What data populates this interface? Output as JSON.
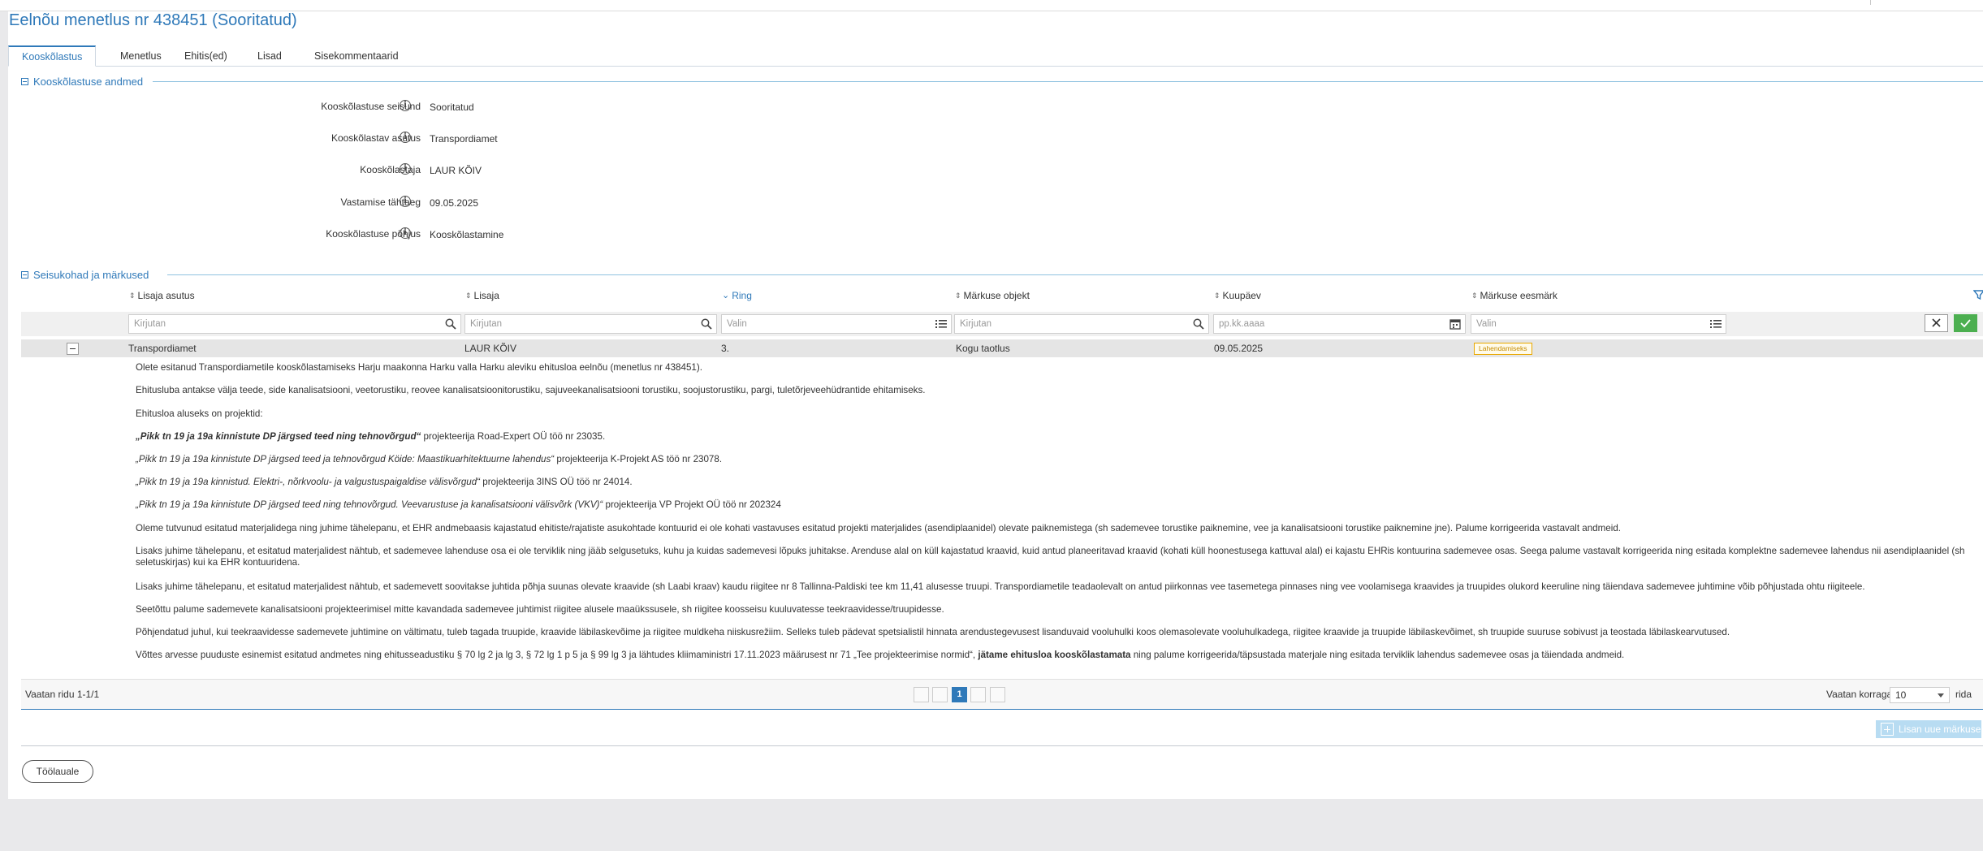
{
  "page": {
    "title": "Eelnõu menetlus nr 438451 (Sooritatud)"
  },
  "tabs": [
    {
      "label": "Kooskõlastus"
    },
    {
      "label": "Menetlus"
    },
    {
      "label": "Ehitis(ed)"
    },
    {
      "label": "Lisad"
    },
    {
      "label": "Sisekommentaarid"
    }
  ],
  "section1": {
    "title": "Kooskõlastuse andmed",
    "fields": [
      {
        "label": "Kooskõlastuse seisund",
        "value": "Sooritatud"
      },
      {
        "label": "Kooskõlastav asutus",
        "value": "Transpordiamet"
      },
      {
        "label": "Kooskõlastaja",
        "value": "LAUR KÕIV"
      },
      {
        "label": "Vastamise tähtaeg",
        "value": "09.05.2025"
      },
      {
        "label": "Kooskõlastuse põhjus",
        "value": "Kooskõlastamine"
      }
    ],
    "info_glyph": "i"
  },
  "section2": {
    "title": "Seisukohad ja märkused"
  },
  "table": {
    "columns": [
      {
        "label": "Lisaja asutus",
        "sort": "⇕"
      },
      {
        "label": "Lisaja",
        "sort": "⇕"
      },
      {
        "label": "Ring",
        "sort": "⌄"
      },
      {
        "label": "Märkuse objekt",
        "sort": "⇕"
      },
      {
        "label": "Kuupäev",
        "sort": "⇕"
      },
      {
        "label": "Märkuse eesmärk",
        "sort": "⇕"
      }
    ],
    "filters": [
      {
        "placeholder": "Kirjutan",
        "icon": "search-icon"
      },
      {
        "placeholder": "Kirjutan",
        "icon": "search-icon"
      },
      {
        "placeholder": "Valin",
        "icon": "list-icon"
      },
      {
        "placeholder": "Kirjutan",
        "icon": "search-icon"
      },
      {
        "placeholder": "pp.kk.aaaa",
        "icon": "calendar-icon"
      },
      {
        "placeholder": "Valin",
        "icon": "list-icon"
      }
    ],
    "row": {
      "asutus": "Transpordiamet",
      "lisaja": "LAUR KÕIV",
      "ring": "3.",
      "objekt": "Kogu taotlus",
      "kuupaev": "09.05.2025",
      "eesmark": "Lahendamiseks"
    },
    "body": {
      "p1": "Olete esitanud Transpordiametile kooskõlastamiseks Harju maakonna Harku valla Harku aleviku ehitusloa eelnõu (menetlus nr 438451).",
      "p2": "Ehitusluba antakse välja teede, side kanalisatsiooni, veetorustiku, reovee kanalisatsioonitorustiku, sajuveekanalisatsiooni torustiku, soojustorustiku, pargi, tuletõrjeveehüdrantide ehitamiseks.",
      "p3": "Ehitusloa aluseks on projektid:",
      "p4_bold": "„Pikk tn 19 ja 19a kinnistute DP järgsed teed ning tehnovõrgud“",
      "p4_rest": " projekteerija Road-Expert OÜ töö nr 23035.",
      "p5_italic": "„Pikk tn 19 ja 19a kinnistute DP järgsed teed ja tehnovõrgud Köide: Maastikuarhitektuurne lahendus“",
      "p5_rest": " projekteerija K-Projekt AS töö nr 23078.",
      "p6_italic": "„Pikk tn 19 ja 19a kinnistud. Elektri-, nõrkvoolu- ja valgustuspaigaldise välisvõrgud“",
      "p6_rest": " projekteerija 3INS OÜ töö nr 24014.",
      "p7_italic": "„Pikk tn 19 ja 19a kinnistute DP järgsed teed ning tehnovõrgud. Veevarustuse ja kanalisatsiooni välisvõrk (VKV)“",
      "p7_rest": " projekteerija VP Projekt OÜ töö nr 202324",
      "p8": "Oleme tutvunud esitatud materjalidega ning juhime tähelepanu, et EHR andmebaasis kajastatud ehitiste/rajatiste asukohtade kontuurid ei ole kohati vastavuses esitatud projekti materjalides (asendiplaanidel) olevate paiknemistega (sh sademevee torustike paiknemine, vee ja kanalisatsiooni torustike paiknemine jne). Palume korrigeerida vastavalt andmeid.",
      "p9": "Lisaks juhime tähelepanu, et esitatud materjalidest nähtub, et sademevee lahenduse osa ei ole terviklik ning jääb selgusetuks, kuhu ja kuidas sademevesi lõpuks juhitakse. Arenduse alal on küll kajastatud kraavid, kuid antud planeeritavad kraavid (kohati küll hoonestusega kattuval alal) ei kajastu EHRis kontuurina sademevee osas. Seega palume vastavalt korrigeerida ning esitada komplektne sademevee lahendus nii asendiplaanidel (sh seletuskirjas) kui ka EHR kontuuridena.",
      "p10": "Lisaks juhime tähelepanu, et esitatud materjalidest nähtub, et sademevett soovitakse juhtida põhja suunas olevate kraavide (sh Laabi kraav) kaudu riigitee nr 8 Tallinna-Paldiski tee km 11,41 alusesse truupi. Transpordiametile teadaolevalt on antud piirkonnas vee tasemetega pinnases ning vee voolamisega kraavides ja truupides olukord keeruline ning täiendava sademevee juhtimine võib põhjustada ohtu riigiteele.",
      "p11": "Seetõttu palume sademevete kanalisatsiooni projekteerimisel mitte kavandada sademevee juhtimist riigitee alusele maaükssusele, sh riigitee koosseisu kuuluvatesse teekraavidesse/truupidesse.",
      "p12": "Põhjendatud juhul, kui teekraavidesse sademevete juhtimine on vältimatu, tuleb tagada truupide, kraavide läbilaskevõime ja riigitee muldkeha niiskusrežiim. Selleks tuleb pädevat spetsialistil hinnata arendustegevusest lisanduvaid vooluhulki koos olemasolevate vooluhulkadega, riigitee kraavide ja truupide läbilaskevõimet, sh truupide suuruse sobivust ja teostada läbilaskearvutused.",
      "p13_a": "Võttes arvesse puuduste esinemist esitatud andmetes ning ehitusseadustiku § 70 lg 2 ja lg 3, § 72 lg 1 p 5 ja § 99 lg 3 ja lähtudes kliimaministri 17.11.2023 määrusest nr 71 „Tee projekteerimise normid“, ",
      "p13_b": "jätame ehitusloa kooskõlastamata",
      "p13_c": " ning palume korrigeerida/täpsustada materjale ning esitada terviklik lahendus sademevee osas ja täiendada andmeid."
    },
    "footer": {
      "rows_info": "Vaatan ridu 1-1/1",
      "page_current": "1",
      "per_page_label": "Vaatan korraga",
      "per_page_value": "10",
      "per_page_suffix": "rida"
    }
  },
  "actions": {
    "add_label": "Lisan uue märkuse",
    "back_label": "Töölauale"
  },
  "colors": {
    "accent": "#2f79b9",
    "badge": "#e9a800",
    "ok": "#4caf50"
  }
}
